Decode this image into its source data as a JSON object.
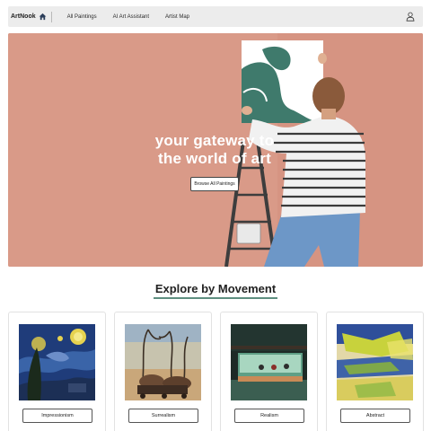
{
  "navbar": {
    "brand": "ArtNook",
    "brand_icon": "home-icon",
    "links": [
      "All Paintings",
      "AI Art Assistant",
      "Artist Map"
    ],
    "user_icon": "user-icon"
  },
  "hero": {
    "title_line1": "your gateway to",
    "title_line2": "the world of art",
    "button_label": "Browse All Paintings",
    "background_color": "#d99a88"
  },
  "section": {
    "title": "Explore by Movement",
    "accent_color": "#5e8f80"
  },
  "movements": [
    {
      "label": "Impressionism"
    },
    {
      "label": "Surrealism"
    },
    {
      "label": "Realism"
    },
    {
      "label": "Abstract"
    }
  ]
}
